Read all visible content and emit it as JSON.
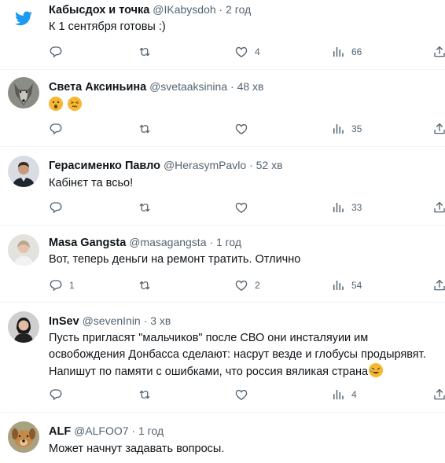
{
  "tweets": [
    {
      "avatar": "twitter-bird-logo",
      "name": "Кабысдох и точка",
      "handle": "@IKabysdoh",
      "time": "2 год",
      "text": "К 1 сентября готовы :)",
      "replies": "",
      "retweets": "",
      "likes": "4",
      "views": "66"
    },
    {
      "avatar": "wolf-photo",
      "name": "Света Аксиньина",
      "handle": "@svetaaksinina",
      "time": "48 хв",
      "text": "",
      "emojis": [
        "face-with-open-mouth",
        "confounded-face"
      ],
      "replies": "",
      "retweets": "",
      "likes": "",
      "views": "35"
    },
    {
      "avatar": "man-in-suit-photo",
      "name": "Герасименко Павло",
      "handle": "@HerasymPavlo",
      "time": "52 хв",
      "text": "Кабінєт та всьо!",
      "replies": "",
      "retweets": "",
      "likes": "",
      "views": "33"
    },
    {
      "avatar": "woman-photo",
      "name": "Masa Gangsta",
      "handle": "@masagangsta",
      "time": "1 год",
      "text": "Вот, теперь деньги на ремонт тратить. Отлично",
      "replies": "1",
      "retweets": "",
      "likes": "2",
      "views": "54"
    },
    {
      "avatar": "woman-dark-hair-photo",
      "name": "InSev",
      "handle": "@sevenInin",
      "time": "3 хв",
      "text_lines": [
        "Пусть пригласят \"мальчиков\" после СВО они инсталяуии им",
        "освобождения Донбасса сделают: насрут везде и глобусы продырявят.",
        "Напишут по памяти с ошибками, что россия вяликая страна"
      ],
      "trailing_emoji": "rolling-on-floor-laughing",
      "replies": "",
      "retweets": "",
      "likes": "",
      "views": "4"
    },
    {
      "avatar": "dog-photo",
      "name": "ALF",
      "handle": "@ALFOO7",
      "time": "1 год",
      "text": "Может начнут задавать вопросы."
    }
  ],
  "separator": "·",
  "colors": {
    "text": "#0f1419",
    "secondary": "#536471",
    "twitter_blue": "#1d9bf0",
    "divider": "#eff3f4"
  }
}
